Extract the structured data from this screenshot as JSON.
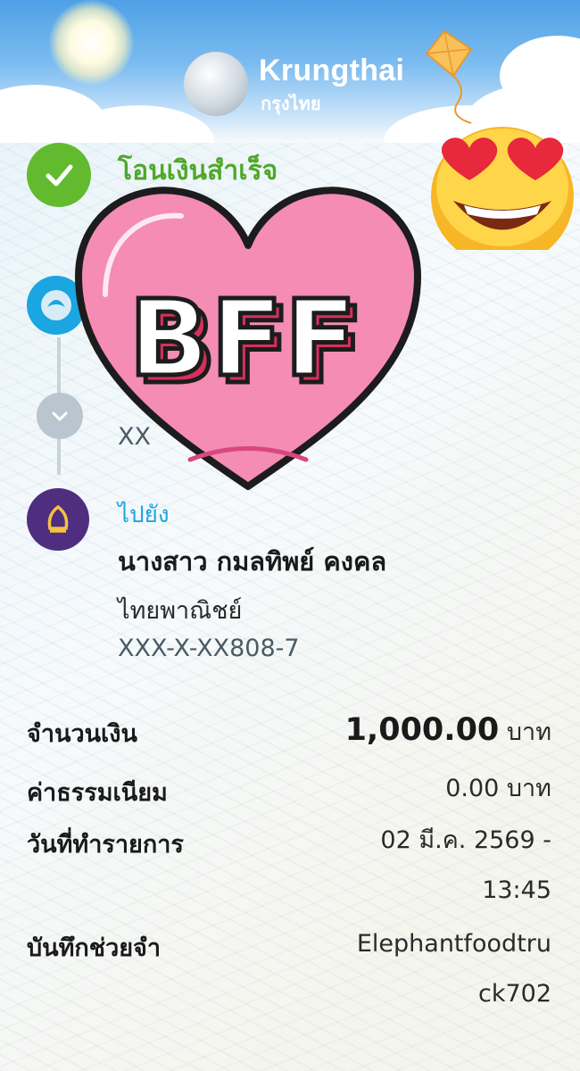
{
  "header": {
    "brand_en": "Krungthai",
    "brand_th": "กรุงไทย"
  },
  "status": {
    "title": "โอนเงินสำเร็จ"
  },
  "from": {
    "account": "XX"
  },
  "to": {
    "label": "ไปยัง",
    "name": "นางสาว กมลทิพย์ คงคล",
    "bank": "ไทยพาณิชย์",
    "account": "XXX-X-XX808-7"
  },
  "details": {
    "amount_label": "จำนวนเงิน",
    "amount_value": "1,000.00",
    "amount_unit": "บาท",
    "fee_label": "ค่าธรรมเนียม",
    "fee_value": "0.00 บาท",
    "date_label": "วันที่ทำรายการ",
    "date_value_line1": "02 มี.ค. 2569 -",
    "date_value_line2": "13:45",
    "memo_label": "บันทึกช่วยจำ",
    "memo_value_line1": "Elephantfoodtru",
    "memo_value_line2": "ck702"
  },
  "stickers": {
    "heart_text": "BFF",
    "emoji": "heart-eyes-emoji"
  },
  "colors": {
    "success_green": "#62bb2f",
    "ktb_blue": "#1ba5e1",
    "scb_purple": "#4f2d7f",
    "heart_pink": "#f48cb4"
  }
}
